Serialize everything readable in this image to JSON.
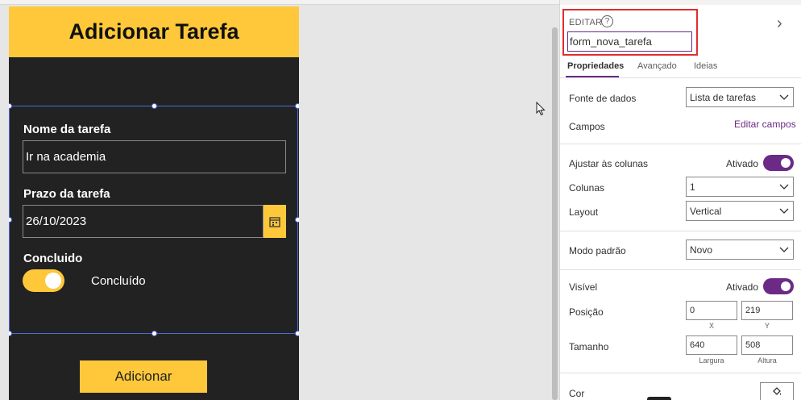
{
  "app": {
    "title": "Adicionar Tarefa",
    "form": {
      "task_name_label": "Nome da tarefa",
      "task_name_value": "Ir na academia",
      "deadline_label": "Prazo da tarefa",
      "deadline_value": "26/10/2023",
      "completed_label": "Concluido",
      "completed_toggle_text": "Concluído",
      "completed_on": true
    },
    "submit_label": "Adicionar",
    "accent_color": "#fec83a",
    "background_color": "#222222"
  },
  "panel": {
    "edit_label": "EDITAR",
    "help_icon": "?",
    "control_name": "form_nova_tarefa",
    "tabs": [
      {
        "label": "Propriedades",
        "active": true
      },
      {
        "label": "Avançado",
        "active": false
      },
      {
        "label": "Ideias",
        "active": false
      }
    ],
    "data_source": {
      "label": "Fonte de dados",
      "value": "Lista de tarefas"
    },
    "fields": {
      "label": "Campos",
      "link": "Editar campos"
    },
    "snap_to_columns": {
      "label": "Ajustar às colunas",
      "state": "Ativado",
      "on": true
    },
    "columns": {
      "label": "Colunas",
      "value": "1"
    },
    "layout": {
      "label": "Layout",
      "value": "Vertical"
    },
    "default_mode": {
      "label": "Modo padrão",
      "value": "Novo"
    },
    "visible": {
      "label": "Visível",
      "state": "Ativado",
      "on": true
    },
    "position": {
      "label": "Posição",
      "x": "0",
      "y": "219",
      "x_caption": "X",
      "y_caption": "Y"
    },
    "size": {
      "label": "Tamanho",
      "width": "640",
      "height": "508",
      "width_caption": "Largura",
      "height_caption": "Altura"
    },
    "color": {
      "label": "Cor"
    },
    "accent_color": "#6b2a85"
  }
}
